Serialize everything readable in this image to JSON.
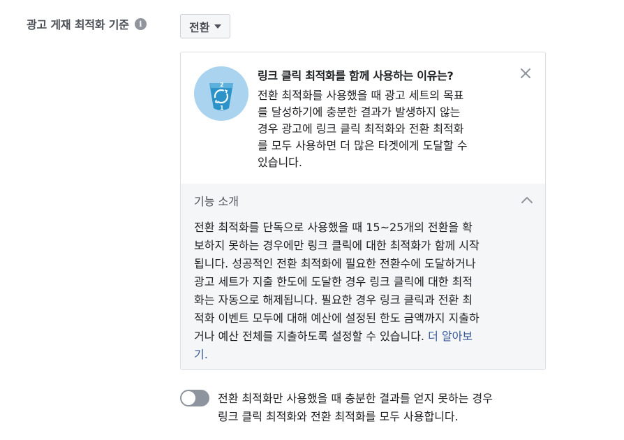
{
  "field": {
    "label": "광고 게재 최적화 기준",
    "info_icon": "info-icon",
    "info_glyph": "i"
  },
  "dropdown": {
    "selected": "전환",
    "icon": "caret-down-icon"
  },
  "tip": {
    "icon": "conversion-cycle-icon",
    "title": "링크 클릭 최적화를 함께 사용하는 이유는?",
    "body_lines": [
      "전환 최적화를 사용했을 때 광고 세트의 목표",
      "를 달성하기에 충분한 결과가 발생하지 않는",
      "경우 광고에 링크 클릭 최적화와 전환 최적화",
      "를 모두 사용하면 더 많은 타겟에게 도달할 수",
      "있습니다."
    ],
    "close_icon": "close-icon"
  },
  "feature": {
    "title": "기능 소개",
    "collapse_icon": "chevron-up-icon",
    "body_lines": [
      "전환 최적화를 단독으로 사용했을 때 15~25개의 전환을 확",
      "보하지 못하는 경우에만 링크 클릭에 대한 최적화가 함께 시작",
      "됩니다. 성공적인 전환 최적화에 필요한 전환수에 도달하거나",
      "광고 세트가 지출 한도에 도달한 경우 링크 클릭에 대한 최적",
      "화는 자동으로 해제됩니다. 필요한 경우 링크 클릭과 전환 최",
      "적화 이벤트 모두에 대해 예산에 설정된 한도 금액까지 지출하",
      "거나 예산 전체를 지출하도록 설정할 수 있습니다. "
    ],
    "learn_more_part1": "더 알아보",
    "learn_more_part2": "기."
  },
  "toggle": {
    "state": "off",
    "label_lines": [
      "전환 최적화만 사용했을 때 충분한 결과를 얻지 못하는 경우",
      "링크 클릭 최적화와 전환 최적화를 모두 사용합니다."
    ]
  },
  "colors": {
    "link": "#365899",
    "badge_bg": "#a9d3ee",
    "badge_cup": "#2b93c8",
    "toggle_off": "#8d949e",
    "panel_bg": "#f5f6f7"
  }
}
